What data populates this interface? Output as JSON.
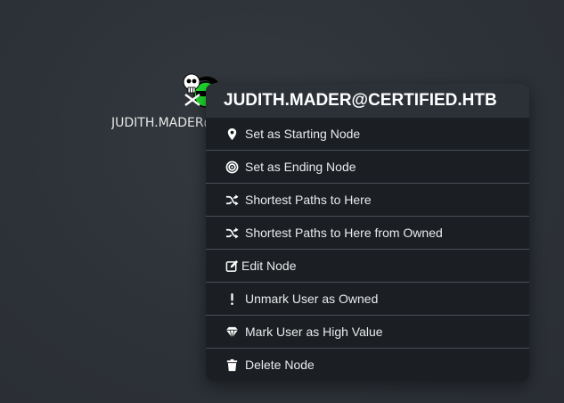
{
  "node": {
    "label": "JUDITH.MADER@CERTIFIED.HTB",
    "icon": "skull-user-icon",
    "colors": {
      "body": "#1ed82c",
      "skull": "#ffffff"
    }
  },
  "context_menu": {
    "title": "JUDITH.MADER@CERTIFIED.HTB",
    "items": [
      {
        "label": "Set as Starting Node",
        "icon": "map-marker-icon"
      },
      {
        "label": "Set as Ending Node",
        "icon": "target-icon"
      },
      {
        "label": "Shortest Paths to Here",
        "icon": "shuffle-icon"
      },
      {
        "label": "Shortest Paths to Here from Owned",
        "icon": "shuffle-icon"
      },
      {
        "label": "Edit Node",
        "icon": "edit-icon"
      },
      {
        "label": "Unmark User as Owned",
        "icon": "exclamation-icon"
      },
      {
        "label": "Mark User as High Value",
        "icon": "diamond-icon"
      },
      {
        "label": "Delete Node",
        "icon": "trash-icon"
      }
    ]
  }
}
